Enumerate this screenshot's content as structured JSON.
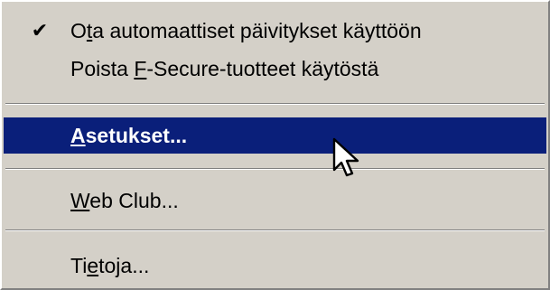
{
  "menu": {
    "items": [
      {
        "pre": "O",
        "mnemonic": "t",
        "post": "a automaattiset päivitykset käyttöön",
        "checked": true,
        "check_glyph": "✔"
      },
      {
        "pre": "Poista ",
        "mnemonic": "F",
        "post": "-Secure-tuotteet käytöstä"
      },
      {
        "pre": "",
        "mnemonic": "A",
        "post": "setukset...",
        "highlighted": true
      },
      {
        "pre": "",
        "mnemonic": "W",
        "post": "eb Club..."
      },
      {
        "pre": "Ti",
        "mnemonic": "e",
        "post": "toja..."
      }
    ]
  },
  "colors": {
    "menu_background": "#d4d0c8",
    "highlight_background": "#0a1f7a",
    "highlight_text": "#ffffff"
  },
  "icons": {
    "checkmark": "checkmark-icon",
    "cursor": "mouse-pointer-icon"
  }
}
